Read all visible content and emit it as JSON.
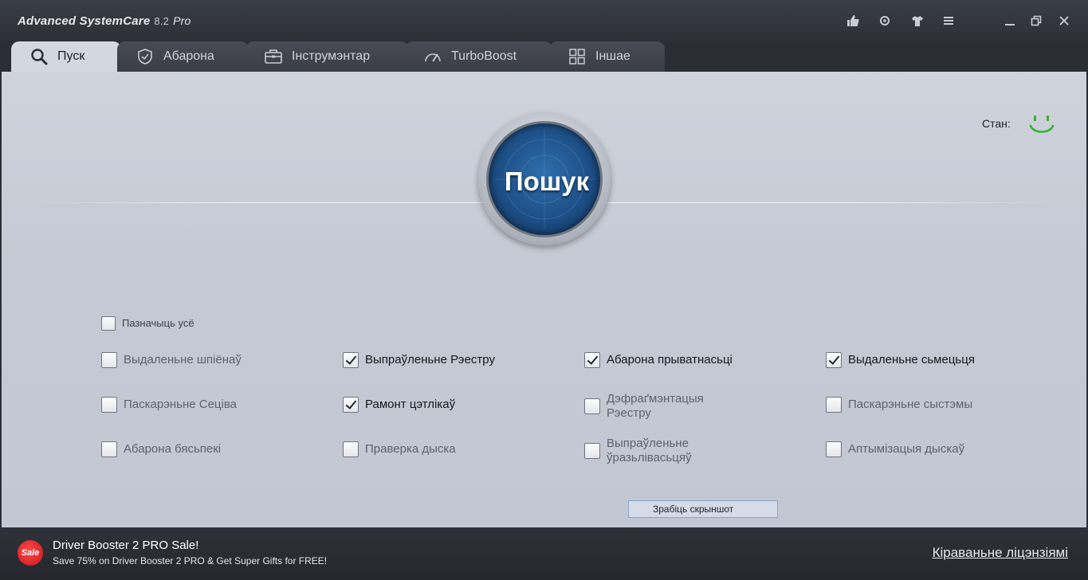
{
  "app": {
    "title": "Advanced SystemCare",
    "version": "8.2",
    "edition": "Pro"
  },
  "titlebar_icons": [
    "thumbs-up-icon",
    "settings-icon",
    "skin-icon",
    "menu-icon",
    "minimize-icon",
    "maximize-icon",
    "close-icon"
  ],
  "tabs": [
    {
      "label": "Пуск",
      "icon": "search-icon",
      "active": true
    },
    {
      "label": "Абарона",
      "icon": "shield-icon",
      "active": false
    },
    {
      "label": "Інструмэнтар",
      "icon": "toolbox-icon",
      "active": false
    },
    {
      "label": "TurboBoost",
      "icon": "speedometer-icon",
      "active": false
    },
    {
      "label": "Іншае",
      "icon": "grid-icon",
      "active": false
    }
  ],
  "scan_button": {
    "label": "Пошук"
  },
  "status": {
    "label": "Стан:",
    "icon": "smiley-icon"
  },
  "select_all": {
    "label": "Пазначыць усё",
    "checked": false
  },
  "checkboxes": [
    {
      "label": "Выдаленьне шпіёнаў",
      "checked": false
    },
    {
      "label": "Выпраўленьне Рэестру",
      "checked": true
    },
    {
      "label": "Абарона прыватнасьці",
      "checked": true
    },
    {
      "label": "Выдаленьне сьмецьця",
      "checked": true
    },
    {
      "label": "Паскарэньне Сеціва",
      "checked": false
    },
    {
      "label": "Рамонт цэтлікаў",
      "checked": true
    },
    {
      "label": "Дэфраґмэнтацыя Рэестру",
      "checked": false
    },
    {
      "label": "Паскарэньне сыстэмы",
      "checked": false
    },
    {
      "label": "Абарона бясьпекі",
      "checked": false
    },
    {
      "label": "Праверка дыска",
      "checked": false
    },
    {
      "label": "Выпраўленьне ўразьлівасьцяў",
      "checked": false
    },
    {
      "label": "Аптымізацыя дыскаў",
      "checked": false
    }
  ],
  "screenshot_button": {
    "label": "Зрабіць скрыншот"
  },
  "promo": {
    "badge": "Sale",
    "title": "Driver Booster 2 PRO Sale!",
    "subtitle": "Save 75% on Driver Booster 2 PRO & Get Super Gifts for FREE!"
  },
  "license_link": "Кіраваньне ліцэнзіямі",
  "colors": {
    "accent_blue": "#1d4f86",
    "smiley_green": "#2fb52f",
    "sale_red": "#c8141b"
  }
}
